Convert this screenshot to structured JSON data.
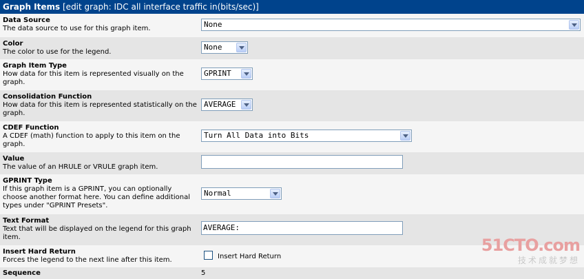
{
  "header": {
    "title": "Graph Items",
    "subtitle": "[edit graph: IDC all interface traffic in(bits/sec)]"
  },
  "fields": {
    "data_source": {
      "name": "Data Source",
      "desc": "The data source to use for this graph item.",
      "value": "None"
    },
    "color": {
      "name": "Color",
      "desc": "The color to use for the legend.",
      "value": "None"
    },
    "graph_item_type": {
      "name": "Graph Item Type",
      "desc": "How data for this item is represented visually on the graph.",
      "value": "GPRINT"
    },
    "consolidation_function": {
      "name": "Consolidation Function",
      "desc": "How data for this item is represented statistically on the graph.",
      "value": "AVERAGE"
    },
    "cdef_function": {
      "name": "CDEF Function",
      "desc": "A CDEF (math) function to apply to this item on the graph.",
      "value": "Turn All Data into Bits"
    },
    "value": {
      "name": "Value",
      "desc": "The value of an HRULE or VRULE graph item.",
      "value": ""
    },
    "gprint_type": {
      "name": "GPRINT Type",
      "desc": "If this graph item is a GPRINT, you can optionally choose another format here. You can define additional types under \"GPRINT Presets\".",
      "value": "Normal"
    },
    "text_format": {
      "name": "Text Format",
      "desc": "Text that will be displayed on the legend for this graph item.",
      "value": "AVERAGE:"
    },
    "insert_hard_return": {
      "name": "Insert Hard Return",
      "desc": "Forces the legend to the next line after this item.",
      "checkbox_label": "Insert Hard Return",
      "checked": false
    },
    "sequence": {
      "name": "Sequence",
      "value": "5"
    }
  },
  "watermark": {
    "logo": "51CTO.com",
    "tagline": "技术成就梦想"
  }
}
